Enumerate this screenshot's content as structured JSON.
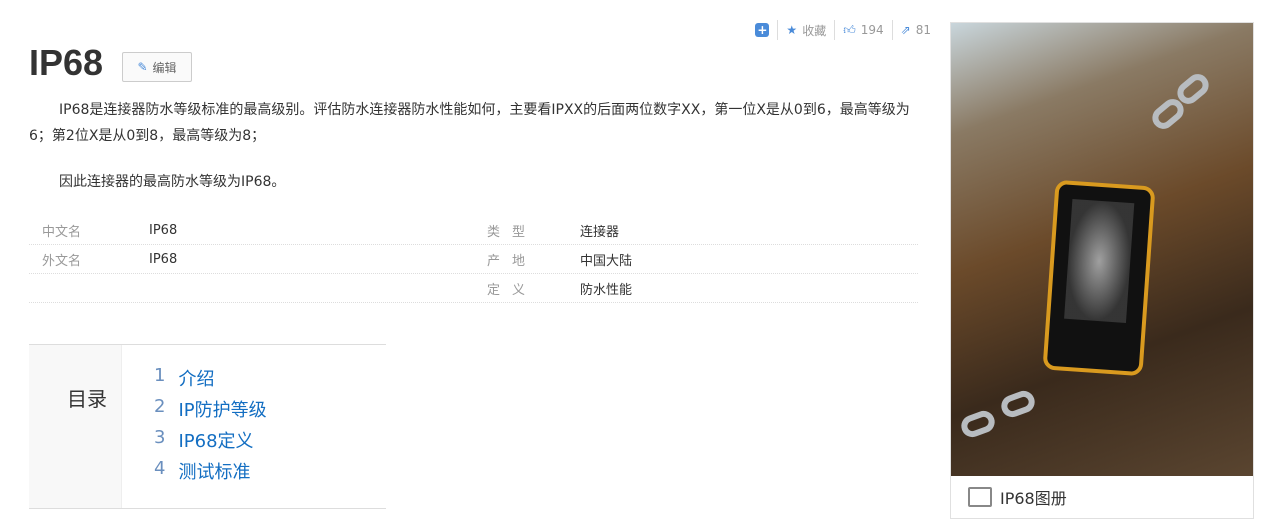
{
  "toolbar": {
    "collect": "收藏",
    "likes": "194",
    "shares": "81"
  },
  "title": "IP68",
  "edit_label": "编辑",
  "paragraphs": [
    "IP68是连接器防水等级标准的最高级别。评估防水连接器防水性能如何，主要看IPXX的后面两位数字XX，第一位X是从0到6，最高等级为6；第2位X是从0到8，最高等级为8；",
    "因此连接器的最高防水等级为IP68。"
  ],
  "info": [
    {
      "k1": "中文名",
      "v1": "IP68",
      "k2": "类型",
      "v2": "连接器"
    },
    {
      "k1": "外文名",
      "v1": "IP68",
      "k2": "产地",
      "v2": "中国大陆"
    },
    {
      "k1": "",
      "v1": "",
      "k2": "定义",
      "v2": "防水性能"
    }
  ],
  "toc": {
    "label": "目录",
    "items": [
      {
        "n": "1",
        "t": "介绍"
      },
      {
        "n": "2",
        "t": "IP防护等级"
      },
      {
        "n": "3",
        "t": "IP68定义"
      },
      {
        "n": "4",
        "t": "测试标准"
      }
    ]
  },
  "album": {
    "caption": "IP68图册"
  }
}
